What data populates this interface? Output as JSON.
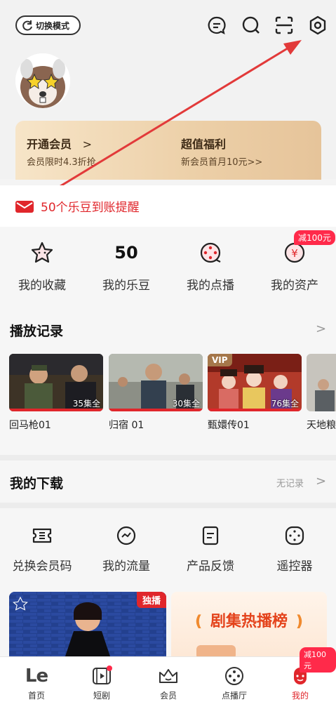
{
  "header": {
    "mode_button_label": "切换模式",
    "icons": [
      "message-icon",
      "search-icon",
      "scan-icon",
      "settings-icon"
    ]
  },
  "vip_card": {
    "left_title": "开通会员",
    "left_sub": "会员限时4.3折抢",
    "right_title": "超值福利",
    "right_sub": "新会员首月10元>>"
  },
  "notice": {
    "text": "50个乐豆到账提醒"
  },
  "quick": {
    "items": [
      {
        "label": "我的收藏"
      },
      {
        "label": "我的乐豆",
        "value": "50"
      },
      {
        "label": "我的点播"
      },
      {
        "label": "我的资产",
        "badge": "减100元"
      }
    ]
  },
  "history": {
    "title": "播放记录",
    "items": [
      {
        "title": "回马枪01",
        "episodes": "35集全"
      },
      {
        "title": "归宿 01",
        "episodes": "30集全"
      },
      {
        "title": "甄嬛传01",
        "episodes": "76集全",
        "tag": "VIP"
      },
      {
        "title": "天地粮"
      }
    ]
  },
  "downloads": {
    "title": "我的下载",
    "status": "无记录"
  },
  "tools": {
    "items": [
      {
        "label": "兑换会员码"
      },
      {
        "label": "我的流量"
      },
      {
        "label": "产品反馈"
      },
      {
        "label": "遥控器"
      }
    ]
  },
  "promo": {
    "exclusive_tag": "独播",
    "ranking_title": "剧集热播榜"
  },
  "nav": {
    "badge": "减100元",
    "items": [
      {
        "label": "首页"
      },
      {
        "label": "短剧"
      },
      {
        "label": "会员"
      },
      {
        "label": "点播厅"
      },
      {
        "label": "我的"
      }
    ]
  },
  "colors": {
    "accent": "#e0262b",
    "badge": "#ff2a4a",
    "vip_gold": "#eccfa7"
  }
}
